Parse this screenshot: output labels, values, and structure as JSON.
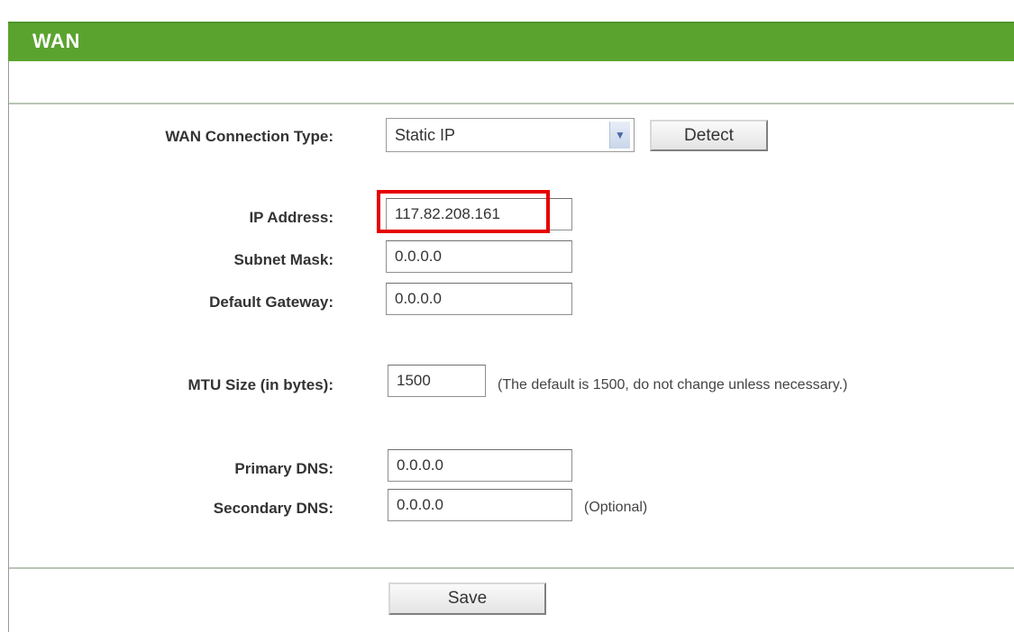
{
  "header": {
    "title": "WAN"
  },
  "form": {
    "wan_type": {
      "label": "WAN Connection Type:",
      "value": "Static IP",
      "detect_label": "Detect"
    },
    "ip_address": {
      "label": "IP Address:",
      "value": "117.82.208.161"
    },
    "subnet_mask": {
      "label": "Subnet Mask:",
      "value": "0.0.0.0"
    },
    "default_gateway": {
      "label": "Default Gateway:",
      "value": "0.0.0.0"
    },
    "mtu": {
      "label": "MTU Size (in bytes):",
      "value": "1500",
      "note": "(The default is 1500, do not change unless necessary.)"
    },
    "primary_dns": {
      "label": "Primary DNS:",
      "value": "0.0.0.0"
    },
    "secondary_dns": {
      "label": "Secondary DNS:",
      "value": "0.0.0.0",
      "note": "(Optional)"
    }
  },
  "footer": {
    "save_label": "Save"
  },
  "colors": {
    "header_green": "#5ba32f",
    "highlight_red": "#e60000"
  },
  "icons": {
    "select_arrow": "chevron-down-icon"
  }
}
